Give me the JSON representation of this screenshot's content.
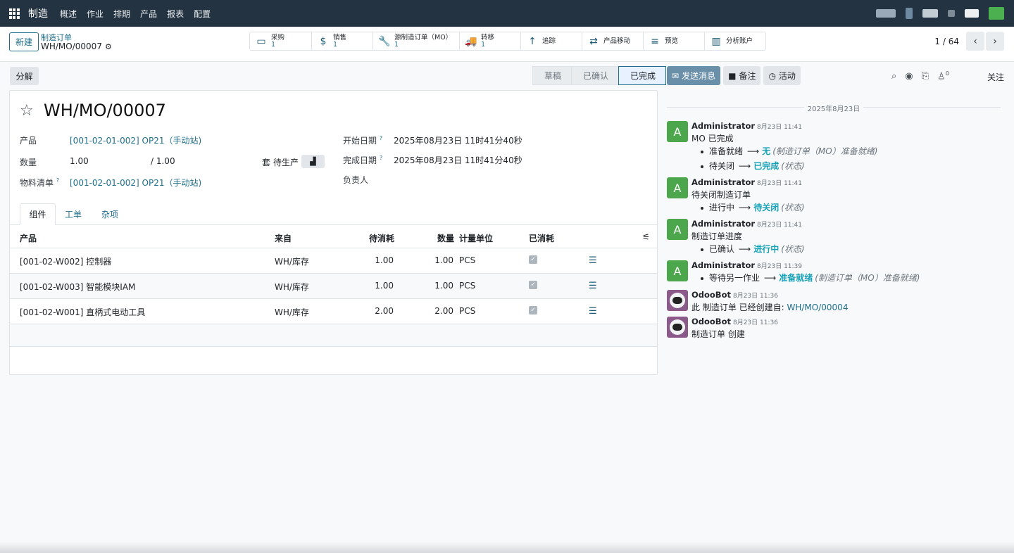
{
  "navbar": {
    "brand": "制造",
    "menu": [
      "概述",
      "作业",
      "排期",
      "产品",
      "报表",
      "配置"
    ]
  },
  "control": {
    "new_label": "新建",
    "breadcrumb": "制造订单",
    "record": "WH/MO/00007",
    "smart_buttons": [
      {
        "icon": "credit-card-icon",
        "label": "采购",
        "count": "1"
      },
      {
        "icon": "dollar-icon",
        "label": "销售",
        "count": "1"
      },
      {
        "icon": "wrench-icon",
        "label": "源制造订单（MO）",
        "count": "1"
      },
      {
        "icon": "truck-icon",
        "label": "转移",
        "count": "1"
      },
      {
        "icon": "arrow-up-icon",
        "label": "追踪",
        "count": ""
      },
      {
        "icon": "exchange-icon",
        "label": "产品移动",
        "count": ""
      },
      {
        "icon": "list-icon",
        "label": "预览",
        "count": ""
      },
      {
        "icon": "bar-chart-icon",
        "label": "分析账户",
        "count": ""
      }
    ],
    "pager": "1 / 64"
  },
  "form": {
    "split_label": "分解",
    "stages": [
      "草稿",
      "已确认",
      "已完成"
    ],
    "active_stage": "已完成",
    "title": "WH/MO/00007",
    "product_label": "产品",
    "product_value": "[001-02-01-002] OP21（手动站)",
    "qty_label": "数量",
    "qty_value": "1.00",
    "qty_max": "/ 1.00",
    "kit_prefix": "套",
    "kit_label": "待生产",
    "bom_label": "物料清单",
    "bom_value": "[001-02-01-002] OP21（手动站)",
    "start_label": "开始日期",
    "start_value": "2025年08月23日 11时41分40秒",
    "end_label": "完成日期",
    "end_value": "2025年08月23日 11时41分40秒",
    "responsible_label": "负责人",
    "help": "?",
    "tabs": [
      "组件",
      "工单",
      "杂项"
    ],
    "columns": [
      "产品",
      "来自",
      "待消耗",
      "数量",
      "计量单位",
      "已消耗"
    ],
    "rows": [
      {
        "product": "[001-02-W002] 控制器",
        "from": "WH/库存",
        "to_consume": "1.00",
        "qty": "1.00",
        "uom": "PCS"
      },
      {
        "product": "[001-02-W003] 智能模块IAM",
        "from": "WH/库存",
        "to_consume": "1.00",
        "qty": "1.00",
        "uom": "PCS"
      },
      {
        "product": "[001-02-W001] 直柄式电动工具",
        "from": "WH/库存",
        "to_consume": "2.00",
        "qty": "2.00",
        "uom": "PCS"
      }
    ]
  },
  "chatter": {
    "send_label": "发送消息",
    "note_label": "备注",
    "activity_label": "活动",
    "follower_count": "0",
    "follow_label": "关注",
    "date": "2025年8月23日",
    "messages": [
      {
        "author": "Administrator",
        "time": "8月23日 11:41",
        "avatar": "A",
        "body": "MO 已完成",
        "tracking": [
          {
            "old": "准备就绪",
            "new": "无",
            "field": "(制造订单（MO）准备就绪)"
          },
          {
            "old": "待关闭",
            "new": "已完成",
            "field": "(状态)"
          }
        ]
      },
      {
        "author": "Administrator",
        "time": "8月23日 11:41",
        "avatar": "A",
        "body": "待关闭制造订单",
        "tracking": [
          {
            "old": "进行中",
            "new": "待关闭",
            "field": "(状态)"
          }
        ]
      },
      {
        "author": "Administrator",
        "time": "8月23日 11:41",
        "avatar": "A",
        "body": "制造订单进度",
        "tracking": [
          {
            "old": "已确认",
            "new": "进行中",
            "field": "(状态)"
          }
        ]
      },
      {
        "author": "Administrator",
        "time": "8月23日 11:39",
        "avatar": "A",
        "body": "",
        "tracking": [
          {
            "old": "等待另一作业",
            "new": "准备就绪",
            "field": "(制造订单（MO）准备就绪)"
          }
        ]
      },
      {
        "author": "OdooBot",
        "time": "8月23日 11:36",
        "body_prefix": "此 制造订单 已经创建自: ",
        "body_link": "WH/MO/00004"
      },
      {
        "author": "OdooBot",
        "time": "8月23日 11:36",
        "body": "制造订单 创建"
      }
    ]
  },
  "colors": {
    "navbar": "#243342",
    "link": "#1f6f8b",
    "tracking_new": "#17a2b8",
    "avatar": "#4ca64c"
  }
}
